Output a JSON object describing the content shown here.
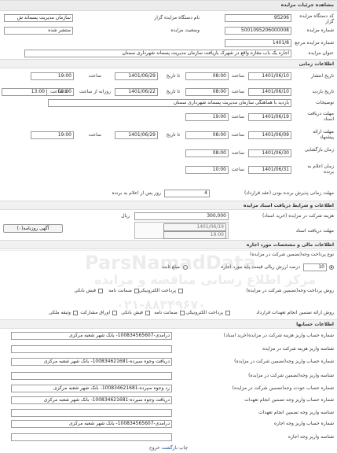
{
  "header": {
    "title": "مشاهده جزئیات مزایده"
  },
  "main": {
    "code_label": "کد دستگاه مزایده گزار",
    "code_value": "95206",
    "org_name_label": "نام دستگاه مزایده گزار",
    "org_name_value": "سازمان مدیریت پسماند ش",
    "auction_no_label": "شماره مزایده",
    "auction_no_value": "5001095206000008",
    "status_label": "وضعیت مزایده",
    "status_value": "منتشر شده",
    "ref_no_label": "شماره مزایده مرجع",
    "ref_no_value": "1401/8",
    "title_label": "عنوان مزایده",
    "title_value": "اجاره یک باب مغازه واقع در شهرک بازیافت سازمان مدیریت پسماند شهرداری سمنان"
  },
  "timing": {
    "section": "اطلاعات زمانی",
    "publish_label": "تاریخ انتشار",
    "publish_from_date": "1401/06/10",
    "publish_time_label": "ساعت",
    "publish_from_time": "08:00",
    "to_date_label": "تا تاریخ",
    "publish_to_date": "1401/06/29",
    "publish_to_time": "19:00",
    "visit_label": "تاریخ بازدید",
    "visit_from_date": "1401/06/10",
    "visit_from_time": "08:00",
    "visit_to_date": "1401/06/22",
    "daily_label": "روزانه از ساعت",
    "visit_daily_from": "08:00",
    "to_time_label": "تا ساعت",
    "visit_daily_to": "13:00",
    "desc_label": "توضیحات",
    "desc_value": "بازدید با هماهنگی سازمان مدیریت پسماند شهرداری سمنان",
    "doc_deadline_label": "مهلت دریافت اسناد",
    "doc_deadline_date": "1401/06/19",
    "doc_deadline_time": "19:00",
    "bid_deadline_label": "مهلت ارائه پیشنهاد",
    "bid_from_date": "1401/06/09",
    "bid_from_time": "08:00",
    "bid_to_date": "1401/06/29",
    "bid_to_time": "19:00",
    "opening_label": "زمان بازگشایی",
    "opening_date": "1401/06/30",
    "opening_time": "08:00",
    "winner_label": "زمان اعلام به برنده",
    "winner_date": "1401/06/31",
    "winner_time": "10:00",
    "contract_label": "مهلت زمانی پذیرش برنده بودن (عقد قرارداد)",
    "contract_days": "4",
    "contract_suffix": "روز پس از اعلام به برنده"
  },
  "docs": {
    "section": "اطلاعات و شرایط دریافت اسناد مزایده",
    "fee_label": "هزینه شرکت در مزایده (خرید اسناد)",
    "fee_value": "300,000",
    "fee_unit": "ریال",
    "receive_label": "مهلت دریافت اسناد",
    "receive_date": "1401/06/19",
    "receive_time": "19:00",
    "ad_button": "آگهی روزنامه(۰)"
  },
  "financial": {
    "section": "اطلاعات مالی و مشخصات مورد اجاره",
    "guarantee_type_label": "نوع پرداخت وجه(تضمین شرکت در مزایده)",
    "percent_value": "10",
    "percent_label": "درصد ارزش ریالی قیمت پایه مورد اجاره",
    "amount_label": "مبلغ ثابت",
    "pay_method_label": "روش پرداخت وجه(تضمین شرکت در مزایده)",
    "pay_options": [
      "پرداخت الکترونیکی",
      "ضمانت نامه",
      "فیش بانکی"
    ],
    "contract_guarantee_label": "روش ارائه تضمین انجام تعهدات قرارداد",
    "contract_options": [
      "پرداخت الکترونیکی",
      "ضمانت نامه",
      "فیش بانکی",
      "اوراق مشارکت",
      "وثیقه ملکی"
    ]
  },
  "accounts": {
    "section": "اطلاعات حسابها",
    "rows": [
      {
        "label": "شماره حساب واریز هزینه شرکت در مزایده(خرید اسناد)",
        "value": "درآمدی-100834565607- بانک شهر شعبه مرکزی"
      },
      {
        "label": "شناسه واریز هزینه شرکت در مزایده",
        "value": ""
      },
      {
        "label": "شماره حساب واریز وجه(تضمین شرکت در مزایده)",
        "value": "دریافت وجوه سپرده-100834621681- بانک شهر شعبه مرکزی"
      },
      {
        "label": "شناسه واریز وجه(تضمین شرکت در مزایده)",
        "value": ""
      },
      {
        "label": "شماره حساب عودت وجه(تضمین شرکت در مزایده)",
        "value": "رد وجوه سپرده-100834621681- بانک شهر شعبه مرکزی"
      },
      {
        "label": "شماره حساب واریز وجه تضمین انجام تعهدات",
        "value": "دریافت وجوه سپرده-100834621681- بانک شهر شعبه مرکزی"
      },
      {
        "label": "شناسه واریز وجه تضمین انجام تعهدات",
        "value": ""
      },
      {
        "label": "شماره حساب واریز وجه اجاره",
        "value": "درآمدی-100834565607- بانک شهر شعبه مرکزی"
      },
      {
        "label": "شناسه واریز وجه اجاره",
        "value": ""
      }
    ]
  },
  "footer": {
    "prefix": "چاپ",
    "link": "بازگشت",
    "suffix": "خروج"
  },
  "watermark": {
    "brand": "ParsNamadData",
    "line1": "مرکز اطلاع رسانی مناقصه و مزایده",
    "phone": "۰۲۱-۸۸۳۴۹۶۷۰"
  }
}
